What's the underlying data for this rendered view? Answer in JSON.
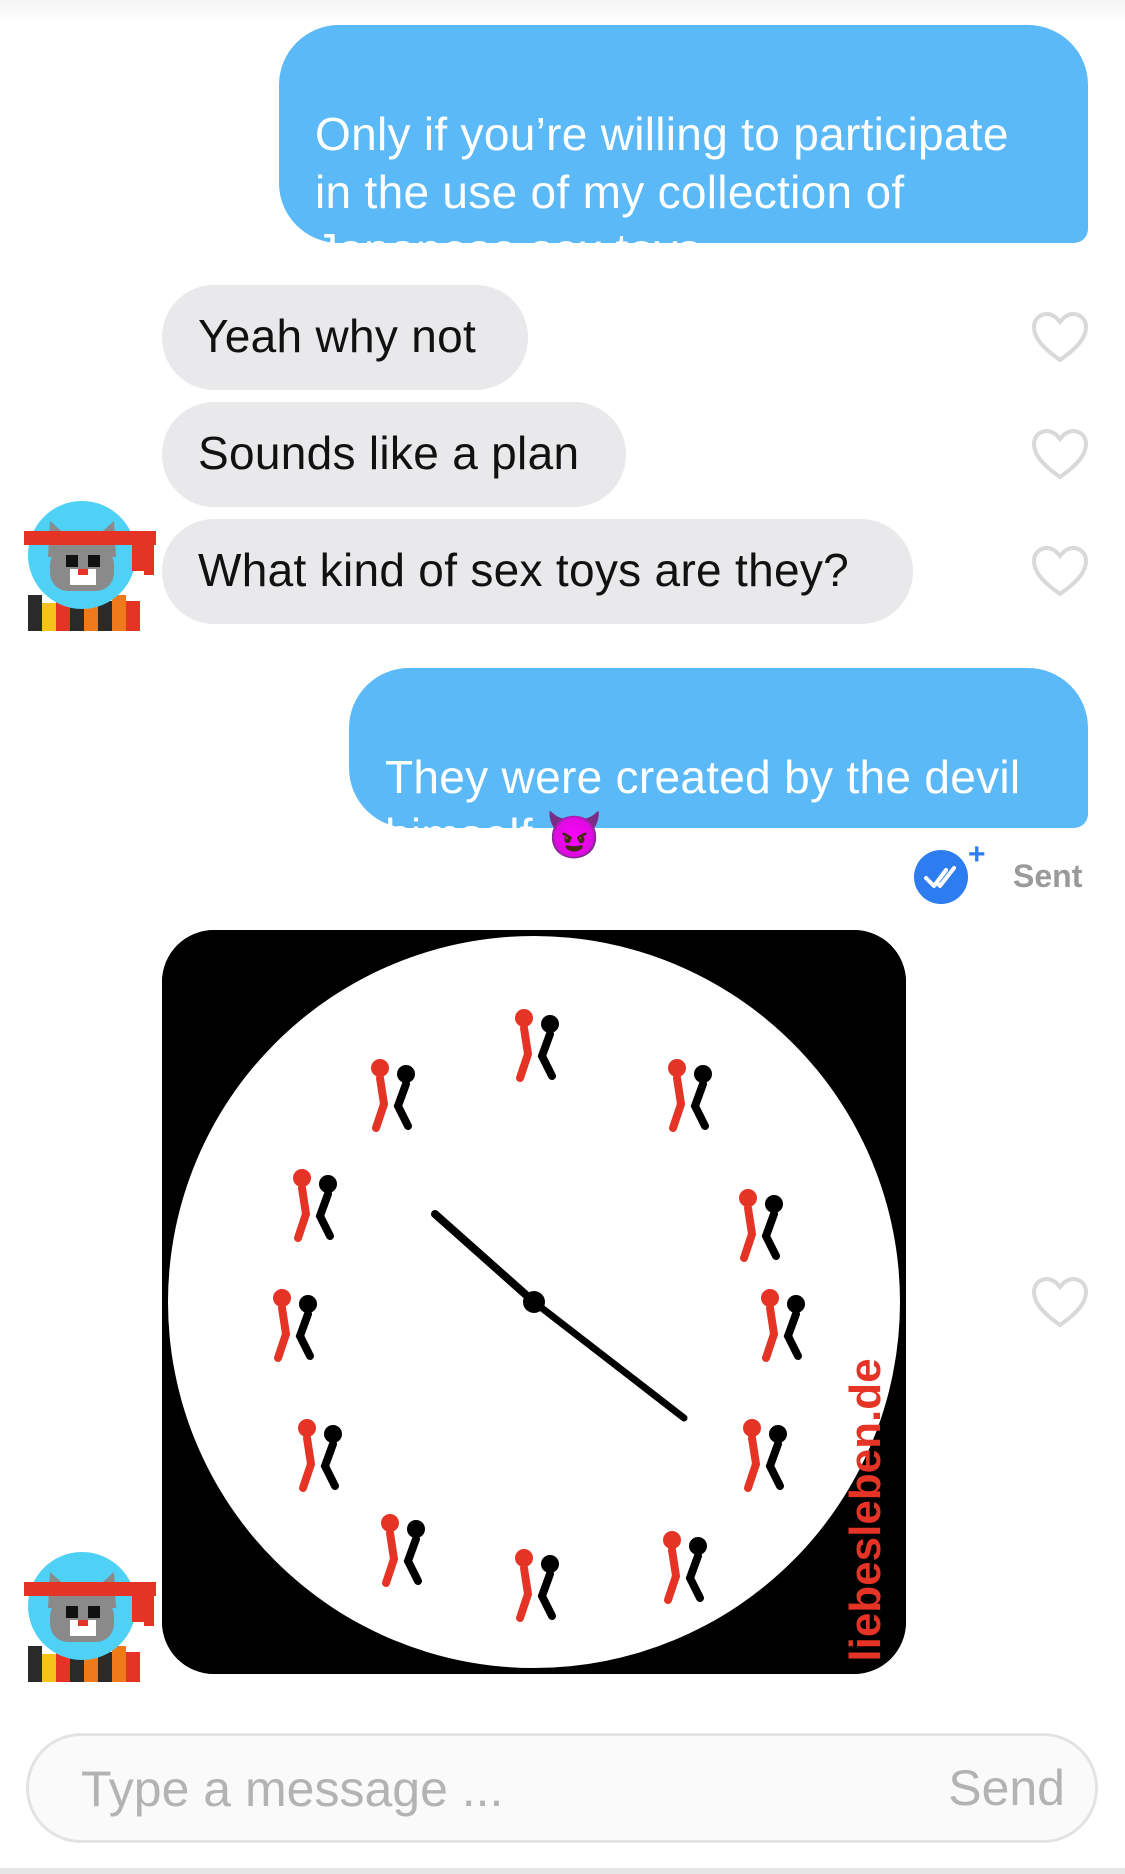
{
  "conversation": {
    "messages": [
      {
        "direction": "outgoing",
        "text": "Only if you’re willing to participate\nin the use of my collection of\nJapanese sex toys"
      },
      {
        "direction": "incoming",
        "text": "Yeah why not"
      },
      {
        "direction": "incoming",
        "text": "Sounds like a plan"
      },
      {
        "direction": "incoming",
        "text": "What kind of sex toys are they?"
      },
      {
        "direction": "outgoing",
        "text": "They were created by the devil\nhimself 😈"
      }
    ],
    "status": {
      "label": "Sent"
    },
    "image_message": {
      "watermark": "liebesleben.de"
    }
  },
  "composer": {
    "placeholder": "Type a message ...",
    "send_label": "Send"
  },
  "icons": {
    "heart": "heart-outline-icon",
    "avatar": "cat-headband-avatar",
    "read_receipt": "double-check-icon"
  },
  "colors": {
    "outgoing_bubble": "#5bb9f7",
    "incoming_bubble": "#e9e9eb",
    "accent_red": "#e53325",
    "read_receipt": "#2d7cf0"
  }
}
